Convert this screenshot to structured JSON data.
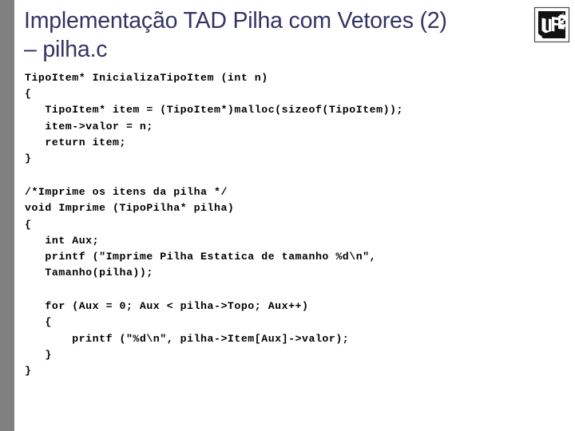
{
  "slide": {
    "title_line1": "Implementação TAD Pilha com Vetores (2)",
    "title_line2": "– pilha.c",
    "title_full": "Implementação TAD Pilha com Vetores (2)\n– pilha.c",
    "title_color": "#333366",
    "background_color": "#ffffff",
    "left_band_color": "#808080",
    "logo": {
      "name": "ufes-logo",
      "text": "UFES",
      "background_color": "#000000",
      "letter_color": "#ffffff"
    }
  },
  "code": {
    "language": "c",
    "text_color": "#000000",
    "groups": [
      {
        "id": "inicializa-tipoitem",
        "lines": [
          "TipoItem* InicializaTipoItem (int n)",
          "{",
          "   TipoItem* item = (TipoItem*)malloc(sizeof(TipoItem));",
          "   item->valor = n;",
          "   return item;",
          "}"
        ]
      },
      {
        "id": "imprime-header",
        "lines": [
          "/*Imprime os itens da pilha */",
          "void Imprime (TipoPilha* pilha)",
          "{",
          "   int Aux;",
          "   printf (\"Imprime Pilha Estatica de tamanho %d\\n\",",
          "   Tamanho(pilha));"
        ]
      },
      {
        "id": "imprime-loop",
        "lines": [
          "   for (Aux = 0; Aux < pilha->Topo; Aux++)",
          "   {",
          "       printf (\"%d\\n\", pilha->Item[Aux]->valor);",
          "   }",
          "}"
        ]
      }
    ]
  }
}
